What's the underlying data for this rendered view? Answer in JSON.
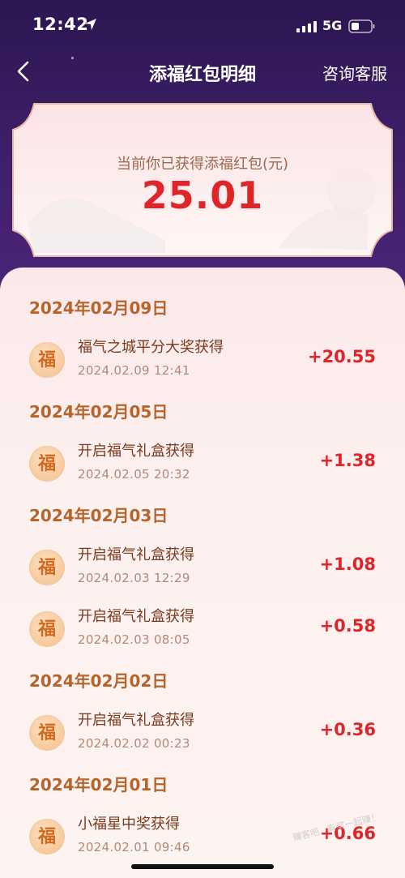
{
  "status_bar": {
    "time": "12:42",
    "network": "5G"
  },
  "nav": {
    "title": "添福红包明细",
    "service_label": "咨询客服"
  },
  "summary": {
    "label": "当前你已获得添福红包(元)",
    "amount": "25.01"
  },
  "groups": [
    {
      "date": "2024年02月09日",
      "records": [
        {
          "icon_char": "福",
          "title": "福气之城平分大奖获得",
          "time": "2024.02.09 12:41",
          "amount": "+20.55"
        }
      ]
    },
    {
      "date": "2024年02月05日",
      "records": [
        {
          "icon_char": "福",
          "title": "开启福气礼盒获得",
          "time": "2024.02.05 20:32",
          "amount": "+1.38"
        }
      ]
    },
    {
      "date": "2024年02月03日",
      "records": [
        {
          "icon_char": "福",
          "title": "开启福气礼盒获得",
          "time": "2024.02.03 12:29",
          "amount": "+1.08"
        },
        {
          "icon_char": "福",
          "title": "开启福气礼盒获得",
          "time": "2024.02.03 08:05",
          "amount": "+0.58"
        }
      ]
    },
    {
      "date": "2024年02月02日",
      "records": [
        {
          "icon_char": "福",
          "title": "开启福气礼盒获得",
          "time": "2024.02.02 00:23",
          "amount": "+0.36"
        }
      ]
    },
    {
      "date": "2024年02月01日",
      "records": [
        {
          "icon_char": "福",
          "title": "小福星中奖获得",
          "time": "2024.02.01 09:46",
          "amount": "+0.66"
        }
      ]
    }
  ],
  "watermark": "赚客吧，有奖一起赚！",
  "colors": {
    "header_bg": "#3f1f6a",
    "amount_red": "#e0252a",
    "date_brown": "#b4642c",
    "title_brown": "#7a3a1c"
  },
  "icons": [
    "location-arrow-icon",
    "signal-icon",
    "battery-icon",
    "back-arrow-icon",
    "fu-badge-icon"
  ]
}
